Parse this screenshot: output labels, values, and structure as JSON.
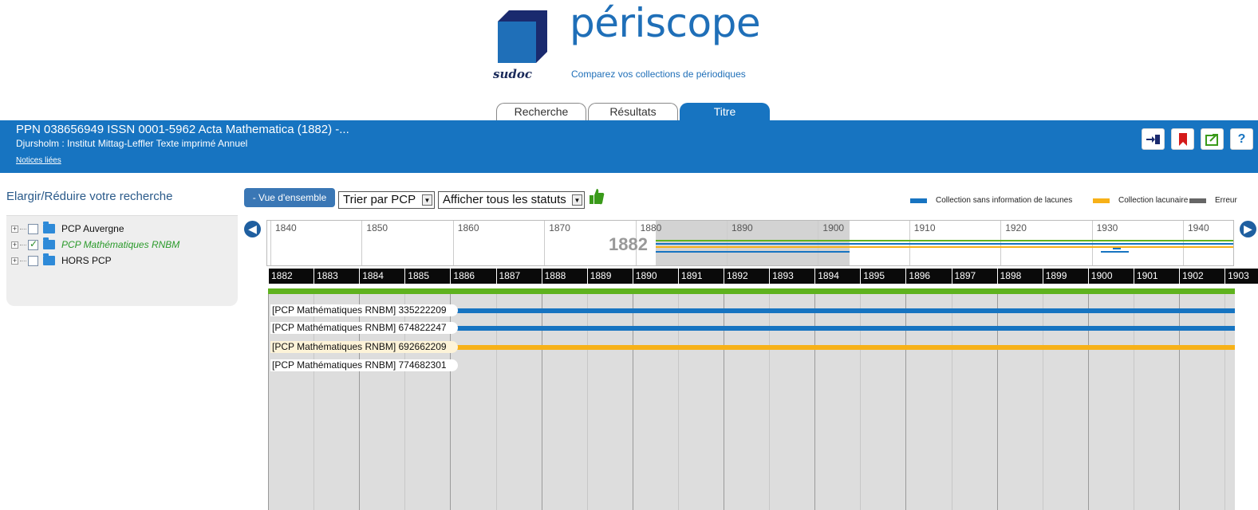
{
  "logo": {
    "brand": "périscope",
    "sub_brand": "sudoc",
    "tagline": "Comparez vos collections de périodiques"
  },
  "tabs": [
    {
      "label": "Recherche",
      "active": false
    },
    {
      "label": "Résultats",
      "active": false
    },
    {
      "label": "Titre",
      "active": true
    }
  ],
  "header": {
    "title": "PPN 038656949 ISSN 0001-5962  Acta Mathematica (1882) -...",
    "subtitle": "Djursholm : Institut Mittag-Leffler Texte imprimé Annuel",
    "link": "Notices liées",
    "icons": [
      "login-icon",
      "bookmark-icon",
      "export-icon",
      "help-icon"
    ],
    "help_glyph": "?"
  },
  "left_panel": {
    "title": "Elargir/Réduire votre recherche",
    "tree": [
      {
        "label": "PCP Auvergne",
        "checked": false
      },
      {
        "label": "PCP Mathématiques RNBM",
        "checked": true
      },
      {
        "label": "HORS PCP",
        "checked": false
      }
    ]
  },
  "toolbar": {
    "overview_button": "- Vue d'ensemble",
    "sort_select": "Trier par PCP",
    "status_select": "Afficher tous les statuts"
  },
  "legend": [
    {
      "label": "Collection sans information de lacunes",
      "color": "#1774c1"
    },
    {
      "label": "Collection lacunaire",
      "color": "#f7b118"
    },
    {
      "label": "Erreur",
      "color": "#666666"
    }
  ],
  "timeline": {
    "overview_ticks": [
      "1840",
      "1850",
      "1860",
      "1870",
      "1880",
      "1890",
      "1900",
      "1910",
      "1920",
      "1930",
      "1940"
    ],
    "selected_year": "1882",
    "years": [
      "1882",
      "1883",
      "1884",
      "1885",
      "1886",
      "1887",
      "1888",
      "1889",
      "1890",
      "1891",
      "1892",
      "1893",
      "1894",
      "1895",
      "1896",
      "1897",
      "1898",
      "1899",
      "1900",
      "1901",
      "1902",
      "1903"
    ]
  },
  "collections": [
    {
      "label": "[PCP Mathématiques RNBM] 335222209",
      "status": "sans information de lacunes",
      "color": "#1774c1"
    },
    {
      "label": "[PCP Mathématiques RNBM] 674822247",
      "status": "sans information de lacunes",
      "color": "#1774c1"
    },
    {
      "label": "[PCP Mathématiques RNBM] 692662209",
      "status": "lacunaire",
      "color": "#f7b118"
    },
    {
      "label": "[PCP Mathématiques RNBM] 774682301",
      "status": "",
      "color": ""
    }
  ]
}
